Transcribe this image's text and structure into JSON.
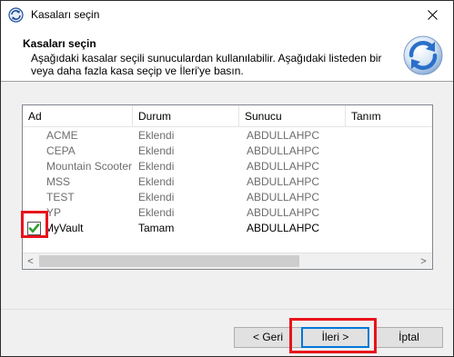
{
  "window": {
    "title": "Kasaları seçin",
    "close_symbol": "✕"
  },
  "header": {
    "title": "Kasaları seçin",
    "description": "Aşağıdaki kasalar seçili sunuculardan kullanılabilir. Aşağıdaki listeden bir veya daha fazla kasa seçip ve İleri'ye basın.",
    "icon": "refresh-arrows-icon"
  },
  "list": {
    "columns": [
      "Ad",
      "Durum",
      "Sunucu",
      "Tanım"
    ],
    "rows": [
      {
        "name": "ACME",
        "status": "Eklendi",
        "server": "ABDULLAHPC",
        "description": "",
        "enabled": false
      },
      {
        "name": "CEPA",
        "status": "Eklendi",
        "server": "ABDULLAHPC",
        "description": "",
        "enabled": false
      },
      {
        "name": "Mountain Scooter...",
        "status": "Eklendi",
        "server": "ABDULLAHPC",
        "description": "",
        "enabled": false
      },
      {
        "name": "MSS",
        "status": "Eklendi",
        "server": "ABDULLAHPC",
        "description": "",
        "enabled": false
      },
      {
        "name": "TEST",
        "status": "Eklendi",
        "server": "ABDULLAHPC",
        "description": "",
        "enabled": false
      },
      {
        "name": "YP",
        "status": "Eklendi",
        "server": "ABDULLAHPC",
        "description": "",
        "enabled": false
      },
      {
        "name": "MyVault",
        "status": "Tamam",
        "server": "ABDULLAHPC",
        "description": "",
        "enabled": true,
        "checked": true
      }
    ],
    "scroll_left": "<",
    "scroll_right": ">"
  },
  "buttons": {
    "back": "< Geri",
    "next": "İleri >",
    "cancel": "İptal"
  },
  "colors": {
    "highlight": "#e8141c",
    "checkmark": "#2e9e2e",
    "accent": "#0078d7"
  }
}
